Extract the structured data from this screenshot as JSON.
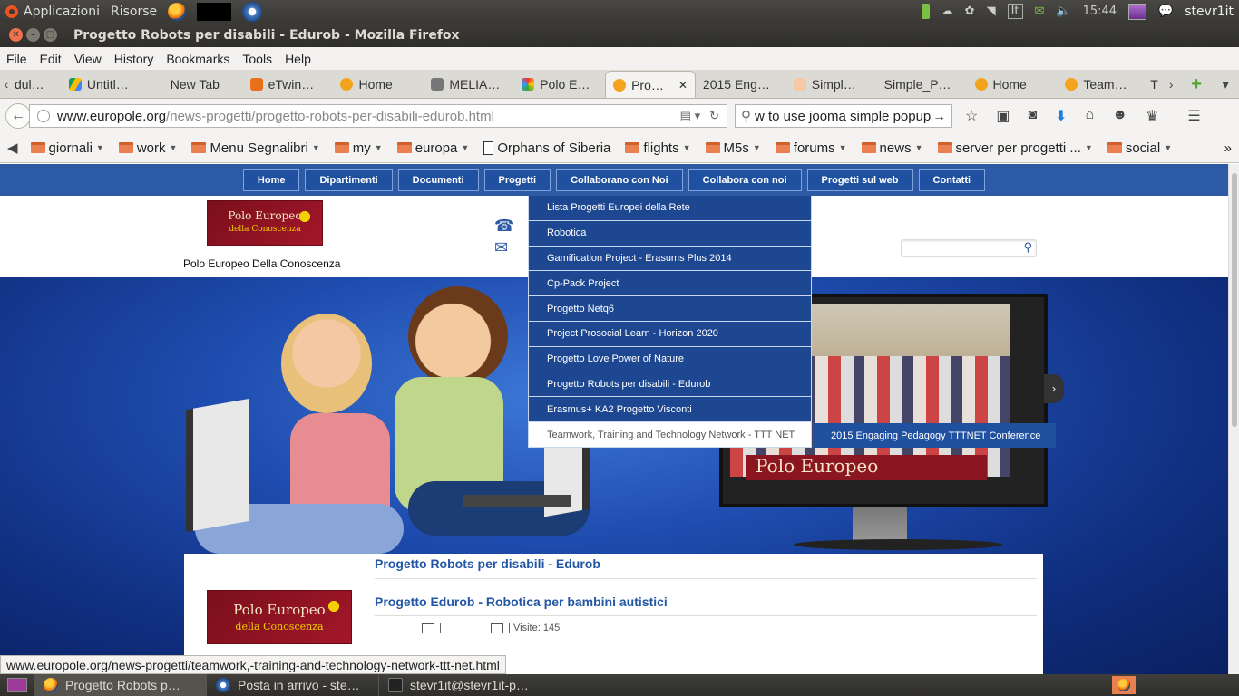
{
  "top_panel": {
    "apps_label": "Applicazioni",
    "places_label": "Risorse",
    "lang_indicator": "It",
    "clock": "15:44",
    "user": "stevr1it"
  },
  "window": {
    "title": "Progetto Robots per disabili - Edurob - Mozilla Firefox"
  },
  "menu": [
    "File",
    "Edit",
    "View",
    "History",
    "Bookmarks",
    "Tools",
    "Help"
  ],
  "tabs": [
    {
      "label": "dul…",
      "icon": "page-icon"
    },
    {
      "label": "Untitl…",
      "icon": "google-drive-icon"
    },
    {
      "label": "New Tab",
      "icon": ""
    },
    {
      "label": "eTwin…",
      "icon": "etwinning-icon"
    },
    {
      "label": "Home",
      "icon": "joomla-icon"
    },
    {
      "label": "MELIA…",
      "icon": "melia-icon"
    },
    {
      "label": "Polo E…",
      "icon": "polo-icon"
    },
    {
      "label": "Pro…",
      "icon": "joomla-icon",
      "active": true
    },
    {
      "label": "2015 Eng…",
      "icon": ""
    },
    {
      "label": "Simpl…",
      "icon": "simple-icon"
    },
    {
      "label": "Simple_P…",
      "icon": ""
    },
    {
      "label": "Home",
      "icon": "joomla-icon"
    },
    {
      "label": "Team…",
      "icon": "joomla-icon"
    },
    {
      "label": "T",
      "icon": ""
    }
  ],
  "urlbar": {
    "domain": "www.europole.org",
    "path": "/news-progetti/progetto-robots-per-disabili-edurob.html"
  },
  "searchbar": {
    "value": "w to use jooma simple popup"
  },
  "bookmarks": [
    {
      "label": "giornali",
      "type": "folder"
    },
    {
      "label": "work",
      "type": "folder"
    },
    {
      "label": "Menu Segnalibri",
      "type": "folder"
    },
    {
      "label": "my",
      "type": "folder"
    },
    {
      "label": "europa",
      "type": "folder"
    },
    {
      "label": "Orphans of Siberia",
      "type": "link"
    },
    {
      "label": "flights",
      "type": "folder"
    },
    {
      "label": "M5s",
      "type": "folder"
    },
    {
      "label": "forums",
      "type": "folder"
    },
    {
      "label": "news",
      "type": "folder"
    },
    {
      "label": "server per progetti ...",
      "type": "folder"
    },
    {
      "label": "social",
      "type": "folder"
    }
  ],
  "site": {
    "nav": [
      "Home",
      "Dipartimenti",
      "Documenti",
      "Progetti",
      "Collaborano con Noi",
      "Collabora con noi",
      "Progetti sul web",
      "Contatti"
    ],
    "logo_line1": "Polo Europeo",
    "logo_line2": "della Conoscenza",
    "tagline": "Polo Europeo Della Conoscenza",
    "dropdown": [
      "Lista Progetti Europei della Rete",
      "Robotica",
      "Gamification Project - Erasums Plus 2014",
      "Cp-Pack Project",
      "Progetto Netq6",
      "Project Prosocial Learn - Horizon 2020",
      "Progetto Love Power of Nature",
      "Progetto Robots per disabili - Edurob",
      "Erasmus+ KA2 Progetto Visconti",
      "Teamwork, Training and Technology Network - TTT NET"
    ],
    "submenu_item": "2015 Engaging Pedagogy TTTNET Conference",
    "slideshow_logo": "Polo Europeo",
    "article": {
      "category_title": "Progetto Robots per disabili - Edurob",
      "title": "Progetto Edurob - Robotica per bambini autistici",
      "meta_sep": "|",
      "views": "| Visite: 145"
    }
  },
  "status_url": "www.europole.org/news-progetti/teamwork,-training-and-technology-network-ttt-net.html",
  "taskbar": [
    {
      "label": "Progetto Robots p…",
      "active": true
    },
    {
      "label": "Posta in arrivo - ste…",
      "active": false
    },
    {
      "label": "stevr1it@stevr1it-p…",
      "active": false
    }
  ],
  "colors": {
    "site_blue": "#2c5aa5",
    "dropdown_bg": "#1e4792",
    "accent_firefox": "#e66000"
  }
}
